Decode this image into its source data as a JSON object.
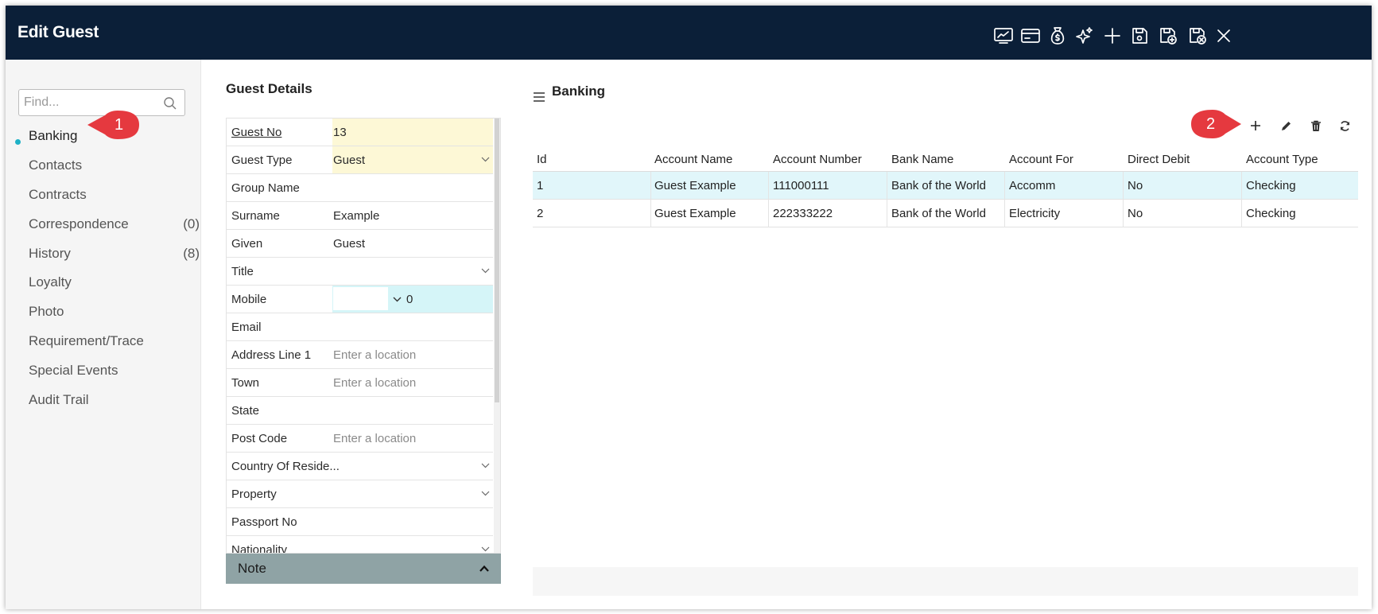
{
  "window": {
    "title": "Edit Guest",
    "toolbar_icons": [
      "reports-icon",
      "card-icon",
      "money-bag-icon",
      "sparkle-icon",
      "add-icon",
      "save-icon",
      "save-new-icon",
      "save-close-icon",
      "close-icon"
    ]
  },
  "sidebar": {
    "find_placeholder": "Find...",
    "items": [
      {
        "label": "Banking",
        "count": "",
        "active": true
      },
      {
        "label": "Contacts",
        "count": ""
      },
      {
        "label": "Contracts",
        "count": ""
      },
      {
        "label": "Correspondence",
        "count": "(0)"
      },
      {
        "label": "History",
        "count": "(8)"
      },
      {
        "label": "Loyalty",
        "count": ""
      },
      {
        "label": "Photo",
        "count": ""
      },
      {
        "label": "Requirement/Trace",
        "count": ""
      },
      {
        "label": "Special Events",
        "count": ""
      },
      {
        "label": "Audit Trail",
        "count": ""
      }
    ]
  },
  "callouts": {
    "one": "1",
    "two": "2"
  },
  "guest_details": {
    "title": "Guest Details",
    "fields": [
      {
        "label": "Guest No",
        "value": "13"
      },
      {
        "label": "Guest Type",
        "value": "Guest"
      },
      {
        "label": "Group Name",
        "value": ""
      },
      {
        "label": "Surname",
        "value": "Example"
      },
      {
        "label": "Given",
        "value": "Guest"
      },
      {
        "label": "Title",
        "value": ""
      },
      {
        "label": "Mobile",
        "value": "0"
      },
      {
        "label": "Email",
        "value": ""
      },
      {
        "label": "Address Line 1",
        "value": "",
        "placeholder": "Enter a location"
      },
      {
        "label": "Town",
        "value": "",
        "placeholder": "Enter a location"
      },
      {
        "label": "State",
        "value": ""
      },
      {
        "label": "Post Code",
        "value": "",
        "placeholder": "Enter a location"
      },
      {
        "label": "Country Of Reside...",
        "value": ""
      },
      {
        "label": "Property",
        "value": ""
      },
      {
        "label": "Passport No",
        "value": ""
      },
      {
        "label": "Nationality",
        "value": ""
      }
    ],
    "note_label": "Note"
  },
  "banking": {
    "title": "Banking",
    "actions": [
      "add-icon",
      "edit-icon",
      "delete-icon",
      "refresh-icon"
    ],
    "columns": [
      "Id",
      "Account Name",
      "Account Number",
      "Bank Name",
      "Account For",
      "Direct Debit",
      "Account Type"
    ],
    "rows": [
      [
        "1",
        "Guest Example",
        "111000111",
        "Bank of the World",
        "Accomm",
        "No",
        "Checking"
      ],
      [
        "2",
        "Guest Example",
        "222333222",
        "Bank of the World",
        "Electricity",
        "No",
        "Checking"
      ]
    ]
  },
  "colors": {
    "titlebar": "#0b1f38",
    "active_dot": "#1eb1c6",
    "callout": "#e5393f",
    "yellow_field": "#fdf8d6",
    "cyan_field": "#d5f5f8",
    "selected_row": "#e1f6fa",
    "note_bar": "#8fa3a5"
  }
}
